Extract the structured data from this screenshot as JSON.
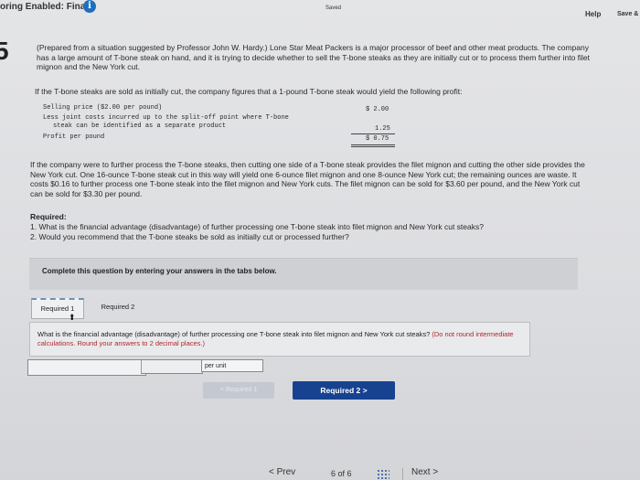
{
  "topbar": {
    "mode_label": "oring Enabled: Final",
    "info_icon": "i",
    "saved": "Saved",
    "help": "Help",
    "save_exit": "Save &"
  },
  "question_number": "5",
  "intro": "(Prepared from a situation suggested by Professor John W. Hardy.) Lone Star Meat Packers is a major processor of beef and other meat products. The company has a large amount of T-bone steak on hand, and it is trying to decide whether to sell the T-bone steaks as they are initially cut or to process them further into filet mignon and the New York cut.",
  "profit_intro": "If the T-bone steaks are sold as initially cut, the company figures that a 1-pound T-bone steak would yield the following profit:",
  "profit_table": {
    "row1_label": "Selling price ($2.00 per pound)",
    "row1_value": "$ 2.00",
    "row2_label_a": "Less joint costs incurred up to the split-off point where T-bone",
    "row2_label_b": "steak can be identified as a separate product",
    "row2_value": "1.25",
    "row3_label": "Profit per pound",
    "row3_value": "$ 0.75"
  },
  "further_processing": "If the company were to further process the T-bone steaks, then cutting one side of a T-bone steak provides the filet mignon and cutting the other side provides the New York cut. One 16-ounce T-bone steak cut in this way will yield one 6-ounce filet mignon and one 8-ounce New York cut; the remaining ounces are waste. It costs $0.16 to further process one T-bone steak into the filet mignon and New York cuts. The filet mignon can be sold for $3.60 per pound, and the New York cut can be sold for $3.30 per pound.",
  "required": {
    "title": "Required:",
    "q1": "1. What is the financial advantage (disadvantage) of further processing one T-bone steak into filet mignon and New York cut steaks?",
    "q2": "2. Would you recommend that the T-bone steaks be sold as initially cut or processed further?"
  },
  "complete_bar": "Complete this question by entering your answers in the tabs below.",
  "tabs": [
    {
      "label": "Required 1"
    },
    {
      "label": "Required 2"
    }
  ],
  "question_box": {
    "text": "What is the financial advantage (disadvantage) of further processing one T-bone steak into filet mignon and New York cut steaks?",
    "hint": "(Do not round intermediate calculations. Round your answers to 2 decimal places.)"
  },
  "answer": {
    "value": "",
    "unit": "per unit"
  },
  "buttons": {
    "prev_required": "< Required 1",
    "next_required": "Required 2  >"
  },
  "nav": {
    "prev": "< Prev",
    "page": "6 of 6",
    "next": "Next >"
  }
}
